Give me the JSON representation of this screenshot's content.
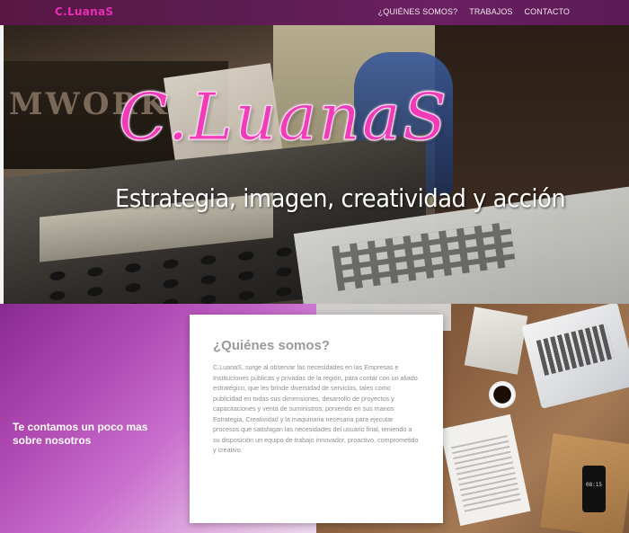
{
  "navbar": {
    "brand": "C.LuanaS",
    "links": [
      "¿QUIÉNES SOMOS?",
      "TRABAJOS",
      "CONTACTO"
    ]
  },
  "hero": {
    "logo_text": "C.LuanaS",
    "tagline": "Estrategia, imagen, creatividad y acción",
    "background_banner_text": "MWORK"
  },
  "about": {
    "left_heading": "Te contamos un poco mas sobre nosotros",
    "card_title": "¿Quiénes somos?",
    "card_body": "C.LuanaS, surge al observar las necesidades en las Empresas e Instituciones públicas y privadas de la región, para contar con un aliado estratégico, que les brinde diversidad de servicios, tales como publicidad en todas sus dimensiones, desarrollo de proyectos y capacitaciones y venta de suministros, poniendo en sus manos Estrategia, Creatividad y la maquinaria necesaria para ejecutar procesos que satisfagan las necesidades del usuario final, teniendo a su disposición un equipo de trabajo innovador, proactivo, comprometido y creativo.",
    "phone_time": "08:15"
  },
  "colors": {
    "brand_pink": "#e62fb6",
    "navbar_bg": "#5b1c4f",
    "section_purple": "#b04ab3"
  }
}
